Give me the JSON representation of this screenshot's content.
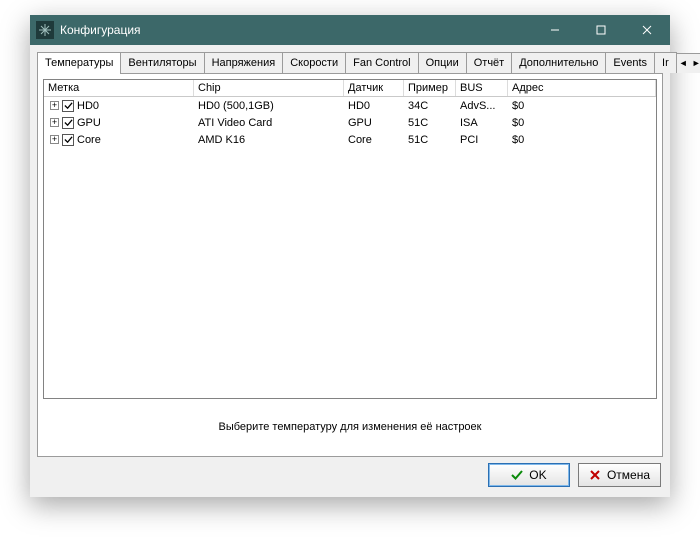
{
  "window": {
    "title": "Конфигурация"
  },
  "tabs": {
    "items": [
      "Температуры",
      "Вентиляторы",
      "Напряжения",
      "Скорости",
      "Fan Control",
      "Опции",
      "Отчёт",
      "Дополнительно",
      "Events",
      "Ir"
    ],
    "active_index": 0
  },
  "grid": {
    "headers": [
      "Метка",
      "Chip",
      "Датчик",
      "Пример",
      "BUS",
      "Адрес"
    ],
    "rows": [
      {
        "checked": true,
        "label": "HD0",
        "chip": "HD0 (500,1GB)",
        "sensor": "HD0",
        "sample": "34C",
        "bus": "AdvS...",
        "addr": "$0"
      },
      {
        "checked": true,
        "label": "GPU",
        "chip": "ATI Video Card",
        "sensor": "GPU",
        "sample": "51C",
        "bus": "ISA",
        "addr": "$0"
      },
      {
        "checked": true,
        "label": "Core",
        "chip": "AMD K16",
        "sensor": "Core",
        "sample": "51C",
        "bus": "PCI",
        "addr": "$0"
      }
    ]
  },
  "hint": "Выберите температуру для изменения её настроек",
  "buttons": {
    "ok": "OK",
    "cancel": "Отмена"
  }
}
